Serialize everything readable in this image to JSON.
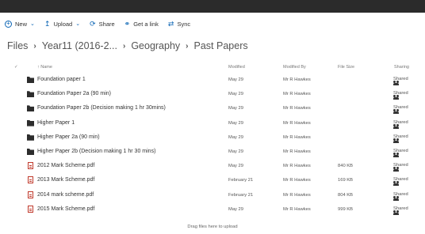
{
  "toolbar": {
    "new_label": "New",
    "upload_label": "Upload",
    "share_label": "Share",
    "link_label": "Get a link",
    "sync_label": "Sync"
  },
  "breadcrumb": [
    "Files",
    "Year11 (2016-2...",
    "Geography",
    "Past Papers"
  ],
  "columns": {
    "name": "↑ Name",
    "modified": "Modified",
    "modified_by": "Modified By",
    "file_size": "File Size",
    "sharing": "Sharing"
  },
  "files": [
    {
      "name": "Foundation paper 1",
      "type": "folder",
      "modified": "May 29",
      "modified_by": "Mr R Hawkes",
      "size": "",
      "sharing": "Shared"
    },
    {
      "name": "Foundation Paper 2a (90 min)",
      "type": "folder",
      "modified": "May 29",
      "modified_by": "Mr R Hawkes",
      "size": "",
      "sharing": "Shared"
    },
    {
      "name": "Foundation Paper 2b (Decision making 1 hr 30mins)",
      "type": "folder",
      "modified": "May 29",
      "modified_by": "Mr R Hawkes",
      "size": "",
      "sharing": "Shared"
    },
    {
      "name": "Higher Paper 1",
      "type": "folder",
      "modified": "May 29",
      "modified_by": "Mr R Hawkes",
      "size": "",
      "sharing": "Shared"
    },
    {
      "name": "Higher Paper 2a (90 min)",
      "type": "folder",
      "modified": "May 29",
      "modified_by": "Mr R Hawkes",
      "size": "",
      "sharing": "Shared"
    },
    {
      "name": "Higher Paper 2b (Decision making 1 hr 30 mins)",
      "type": "folder",
      "modified": "May 29",
      "modified_by": "Mr R Hawkes",
      "size": "",
      "sharing": "Shared"
    },
    {
      "name": "2012 Mark Scheme.pdf",
      "type": "pdf",
      "modified": "May 29",
      "modified_by": "Mr R Hawkes",
      "size": "840 KB",
      "sharing": "Shared"
    },
    {
      "name": "2013 Mark Scheme.pdf",
      "type": "pdf",
      "modified": "February 21",
      "modified_by": "Mr R Hawkes",
      "size": "169 KB",
      "sharing": "Shared"
    },
    {
      "name": "2014 mark scheme.pdf",
      "type": "pdf",
      "modified": "February 21",
      "modified_by": "Mr R Hawkes",
      "size": "804 KB",
      "sharing": "Shared"
    },
    {
      "name": "2015 Mark Scheme.pdf",
      "type": "pdf",
      "modified": "May 29",
      "modified_by": "Mr R Hawkes",
      "size": "999 KB",
      "sharing": "Shared"
    }
  ],
  "dropzone_text": "Drag files here to upload",
  "colors": {
    "accent": "#0a64b4",
    "topbar": "#2b2b2b",
    "pdf": "#c0392b"
  }
}
